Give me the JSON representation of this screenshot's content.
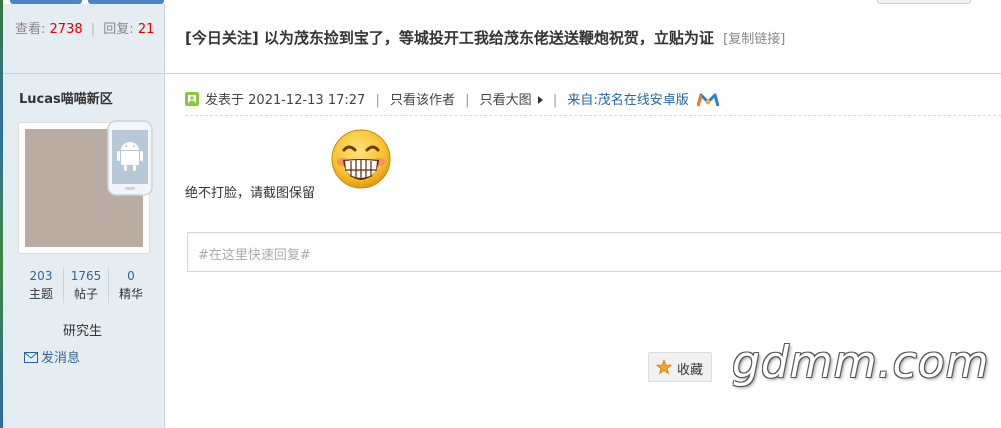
{
  "thread": {
    "views_label": "查看:",
    "views": "2738",
    "replies_label": "回复:",
    "replies": "21",
    "title": "[今日关注] 以为茂东捡到宝了，等城投开工我给茂东佬送送鞭炮祝贺，立贴为证",
    "copy_link": "[复制链接]"
  },
  "author": {
    "name": "Lucas喵喵新区",
    "stats": [
      {
        "value": "203",
        "label": "主题"
      },
      {
        "value": "1765",
        "label": "帖子"
      },
      {
        "value": "0",
        "label": "精华"
      }
    ],
    "rank": "研究生",
    "send_message": "发消息"
  },
  "post": {
    "posted_label": "发表于",
    "posted_at": "2021-12-13 17:27",
    "only_author": "只看该作者",
    "view_large": "只看大图",
    "source": "来自:茂名在线安卓版",
    "body": "绝不打脸，请截图保留"
  },
  "reply_box": {
    "placeholder": "#在这里快速回复#"
  },
  "actions": {
    "favorite": "收藏"
  },
  "watermark": "gdmm.com",
  "icons": {
    "post_icon": "post-icon",
    "android_badge": "android-icon",
    "emoji": "grin-emoji-icon",
    "star": "star-icon",
    "mail": "mail-icon",
    "app_logo": "app-logo-icon"
  },
  "colors": {
    "sidebar_bg": "#e5edf2",
    "count_red": "#e00000",
    "link_blue": "#2366a8",
    "border": "#c2d5e3"
  }
}
